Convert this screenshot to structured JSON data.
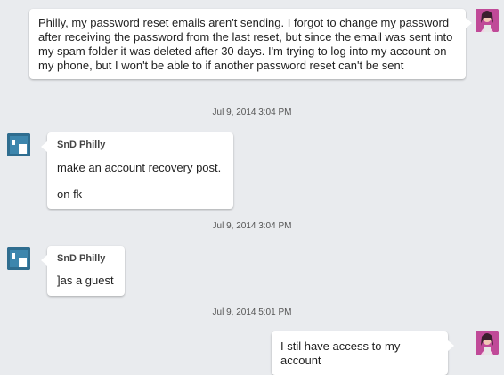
{
  "messages": [
    {
      "side": "self",
      "text": "Philly, my password reset emails aren't sending. I forgot to change my password after receiving the password from the last reset, but since the email was sent into my spam folder it was deleted after 30 days. I'm trying to log into my account on my phone, but I won't be able to if another password reset can't be sent"
    },
    {
      "timestamp": "Jul 9, 2014 3:04 PM"
    },
    {
      "side": "other",
      "sender": "SnD Philly",
      "text": "make an account recovery post.\n\non fk"
    },
    {
      "timestamp": "Jul 9, 2014 3:04 PM"
    },
    {
      "side": "other",
      "sender": "SnD Philly",
      "text": "]as a guest"
    },
    {
      "timestamp": "Jul 9, 2014 5:01 PM"
    },
    {
      "side": "self",
      "text": "I stil have access to my account"
    }
  ],
  "avatars": {
    "self": "avatar-self-icon",
    "other": "avatar-other-icon"
  },
  "colors": {
    "background": "#e9ebee",
    "bubble": "#ffffff",
    "avatar_self": "#c04a98",
    "avatar_other": "#2f6d8f"
  }
}
